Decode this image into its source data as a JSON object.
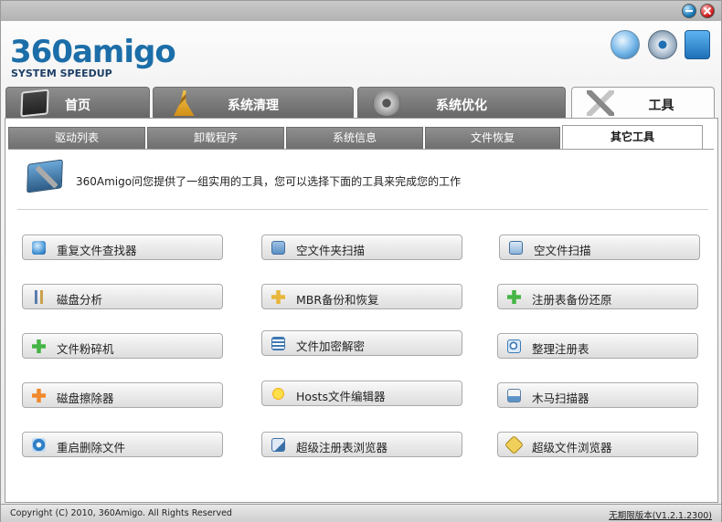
{
  "app": {
    "logo_text": "360amigo",
    "logo_subtitle": "SYSTEM SPEEDUP"
  },
  "header_icons": [
    "refresh-icon",
    "settings-gear-icon",
    "protection-vest-icon"
  ],
  "main_tabs": [
    {
      "label": "首页",
      "icon": "home-monitor-icon",
      "active": false
    },
    {
      "label": "系统清理",
      "icon": "broom-icon",
      "active": false
    },
    {
      "label": "系统优化",
      "icon": "gear-icon",
      "active": false
    },
    {
      "label": "工具",
      "icon": "tools-icon",
      "active": true
    }
  ],
  "sub_tabs": [
    {
      "label": "驱动列表",
      "active": false
    },
    {
      "label": "卸载程序",
      "active": false
    },
    {
      "label": "系统信息",
      "active": false
    },
    {
      "label": "文件恢复",
      "active": false
    },
    {
      "label": "其它工具",
      "active": true
    }
  ],
  "intro": {
    "text": "360Amigo问您提供了一组实用的工具，您可以选择下面的工具来完成您的工作"
  },
  "tools": [
    {
      "label": "重复文件查找器",
      "icon": "duplicate-files-icon"
    },
    {
      "label": "空文件夹扫描",
      "icon": "folder-icon"
    },
    {
      "label": "空文件扫描",
      "icon": "file-scan-icon"
    },
    {
      "label": "磁盘分析",
      "icon": "disk-analyze-icon"
    },
    {
      "label": "MBR备份和恢复",
      "icon": "mbr-puzzle-icon"
    },
    {
      "label": "注册表备份还原",
      "icon": "registry-backup-icon"
    },
    {
      "label": "文件粉碎机",
      "icon": "shredder-icon"
    },
    {
      "label": "文件加密解密",
      "icon": "encrypt-icon"
    },
    {
      "label": "整理注册表",
      "icon": "registry-defrag-icon"
    },
    {
      "label": "磁盘擦除器",
      "icon": "disk-wipe-icon"
    },
    {
      "label": "Hosts文件编辑器",
      "icon": "hosts-editor-icon"
    },
    {
      "label": "木马扫描器",
      "icon": "trojan-scan-icon"
    },
    {
      "label": "重启删除文件",
      "icon": "reboot-delete-icon"
    },
    {
      "label": "超级注册表浏览器",
      "icon": "registry-browser-icon"
    },
    {
      "label": "超级文件浏览器",
      "icon": "file-browser-icon"
    }
  ],
  "status": {
    "copyright": "Copyright (C) 2010, 360Amigo. All Rights Reserved",
    "version": "无期限版本(V1.2.1.2300)"
  }
}
